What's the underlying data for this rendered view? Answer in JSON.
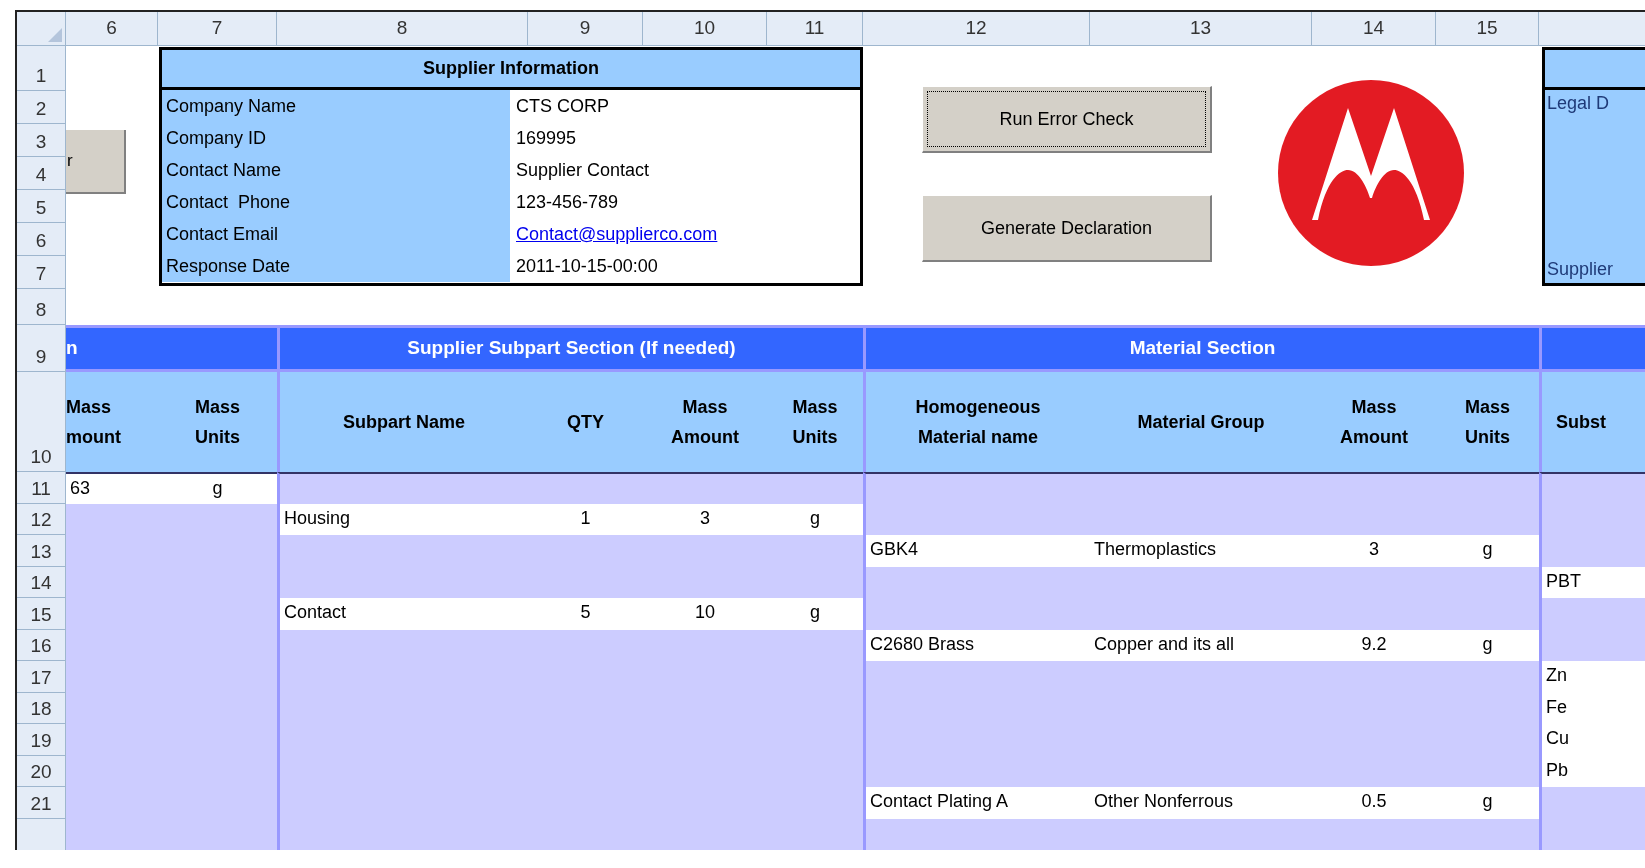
{
  "column_headers": [
    "6",
    "7",
    "8",
    "9",
    "10",
    "11",
    "12",
    "13",
    "14",
    "15"
  ],
  "row_headers": [
    "1",
    "2",
    "3",
    "4",
    "5",
    "6",
    "7",
    "8",
    "9",
    "10",
    "11",
    "12",
    "13",
    "14",
    "15",
    "16",
    "17",
    "18",
    "19",
    "20",
    "21"
  ],
  "side_button": {
    "label": "r"
  },
  "supplier_info": {
    "title": "Supplier Information",
    "fields": [
      {
        "label": "Company Name",
        "value": "CTS CORP",
        "kind": "text"
      },
      {
        "label": "Company ID",
        "value": "169995",
        "kind": "text"
      },
      {
        "label": "Contact Name",
        "value": "Supplier Contact",
        "kind": "text"
      },
      {
        "label": "Contact  Phone",
        "value": "123-456-789",
        "kind": "text"
      },
      {
        "label": "Contact Email",
        "value": "Contact@supplierco.com",
        "kind": "link"
      },
      {
        "label": "Response Date",
        "value": "2011-10-15-00:00",
        "kind": "text"
      }
    ]
  },
  "buttons": [
    {
      "label": "Run Error Check",
      "focused": true
    },
    {
      "label": "Generate Declaration",
      "focused": false
    }
  ],
  "legal_panel": {
    "top": "Legal D",
    "bottom": "Supplier"
  },
  "sections": [
    "n",
    "Supplier Subpart Section (If needed)",
    "Material Section"
  ],
  "column_headings": [
    "Mass\nmount",
    "Mass\nUnits",
    "Subpart Name",
    "QTY",
    "Mass\nAmount",
    "Mass\nUnits",
    "Homogeneous\nMaterial name",
    "Material Group",
    "Mass\nAmount",
    "Mass\nUnits",
    "Subst"
  ],
  "rows": [
    {
      "part": [
        "63",
        "g"
      ]
    },
    {
      "subpart": [
        "Housing",
        "1",
        "3",
        "g"
      ]
    },
    {
      "material": [
        "GBK4",
        "Thermoplastics",
        "3",
        "g"
      ]
    },
    {
      "substance": "PBT"
    },
    {
      "subpart": [
        "Contact",
        "5",
        "10",
        "g"
      ]
    },
    {
      "material": [
        "C2680 Brass",
        "Copper and its all",
        "9.2",
        "g"
      ]
    },
    {
      "substance": "Zn"
    },
    {
      "substance": "Fe"
    },
    {
      "substance": "Cu"
    },
    {
      "substance": "Pb"
    },
    {
      "material": [
        "Contact Plating A",
        "Other Nonferrous",
        "0.5",
        "g"
      ]
    }
  ]
}
